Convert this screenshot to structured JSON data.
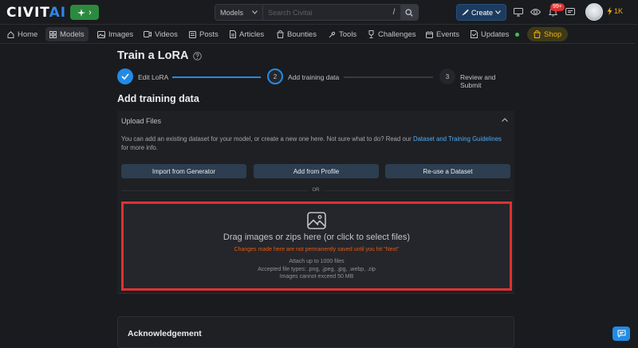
{
  "header": {
    "logo_main": "CIVIT",
    "logo_accent": "AI",
    "search": {
      "select_value": "Models",
      "placeholder": "Search Civitai",
      "shortcut": "/"
    },
    "create_label": "Create",
    "notification_count": "99+",
    "buzz_amount": "1K"
  },
  "nav": {
    "items": [
      {
        "label": "Home",
        "icon": "home-icon"
      },
      {
        "label": "Models",
        "icon": "models-icon"
      },
      {
        "label": "Images",
        "icon": "images-icon"
      },
      {
        "label": "Videos",
        "icon": "videos-icon"
      },
      {
        "label": "Posts",
        "icon": "posts-icon"
      },
      {
        "label": "Articles",
        "icon": "articles-icon"
      },
      {
        "label": "Bounties",
        "icon": "bounties-icon"
      },
      {
        "label": "Tools",
        "icon": "tools-icon"
      },
      {
        "label": "Challenges",
        "icon": "challenges-icon"
      },
      {
        "label": "Events",
        "icon": "events-icon"
      },
      {
        "label": "Updates",
        "icon": "updates-icon"
      },
      {
        "label": "Shop",
        "icon": "shop-icon"
      }
    ]
  },
  "page": {
    "title": "Train a LoRA",
    "steps": [
      {
        "number": "1",
        "label": "Edit LoRA",
        "state": "complete"
      },
      {
        "number": "2",
        "label": "Add training data",
        "state": "active"
      },
      {
        "number": "3",
        "label": "Review and Submit",
        "state": "pending"
      }
    ],
    "section_title": "Add training data"
  },
  "upload": {
    "header": "Upload Files",
    "desc_text": "You can add an existing dataset for your model, or create a new one here. Not sure what to do? Read our ",
    "desc_link": "Dataset and Training Guidelines",
    "desc_tail": " for more info.",
    "buttons": [
      "Import from Generator",
      "Add from Profile",
      "Re-use a Dataset"
    ],
    "or_text": "OR",
    "dropzone": {
      "main": "Drag images or zips here (or click to select files)",
      "warning": "Changes made here are not permanently saved until you hit \"Next\"",
      "limit": "Attach up to 1000 files",
      "types": "Accepted file types: .png, .jpeg, .jpg, .webp, .zip",
      "size": "Images cannot exceed 50 MB"
    }
  },
  "acknowledgement": {
    "title": "Acknowledgement"
  },
  "colors": {
    "accent": "#228be6",
    "highlight_border": "#e03131",
    "warning_text": "#e8590c",
    "background": "#1a1b1e"
  }
}
